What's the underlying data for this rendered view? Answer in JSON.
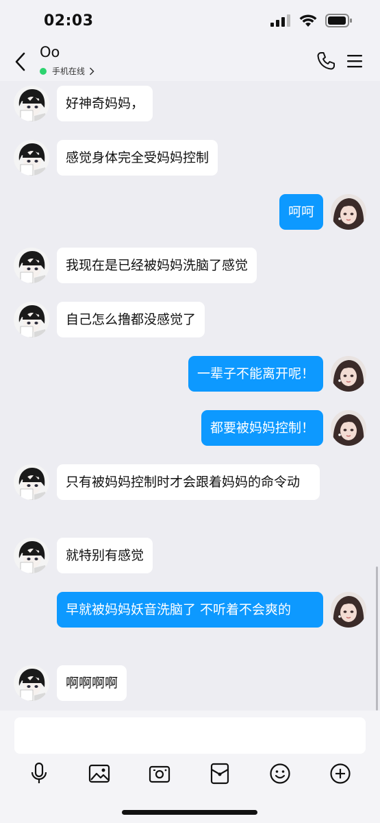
{
  "status_bar": {
    "time": "02:03"
  },
  "header": {
    "contact_name": "Oo",
    "contact_status": "手机在线"
  },
  "messages": [
    {
      "direction": "in",
      "text": "好神奇妈妈，"
    },
    {
      "direction": "in",
      "text": "感觉身体完全受妈妈控制"
    },
    {
      "direction": "out",
      "text": "呵呵"
    },
    {
      "direction": "in",
      "text": "我现在是已经被妈妈洗脑了感觉"
    },
    {
      "direction": "in",
      "text": "自己怎么撸都没感觉了"
    },
    {
      "direction": "out",
      "text": "一辈子不能离开呢！"
    },
    {
      "direction": "out",
      "text": "都要被妈妈控制！"
    },
    {
      "direction": "in",
      "text": "只有被妈妈控制时才会跟着妈妈的命令动"
    },
    {
      "direction": "in",
      "text": "就特别有感觉"
    },
    {
      "direction": "out",
      "text": "早就被妈妈妖音洗脑了 不听着不会爽的"
    },
    {
      "direction": "in",
      "text": "啊啊啊啊"
    }
  ],
  "input": {
    "value": ""
  },
  "toolbar_icons": [
    "microphone-icon",
    "image-icon",
    "camera-icon",
    "red-packet-icon",
    "emoji-icon",
    "plus-icon"
  ],
  "colors": {
    "outgoing_bubble": "#0d99ff",
    "incoming_bubble": "#ffffff",
    "online": "#2dd36f",
    "background": "#ededf2"
  }
}
